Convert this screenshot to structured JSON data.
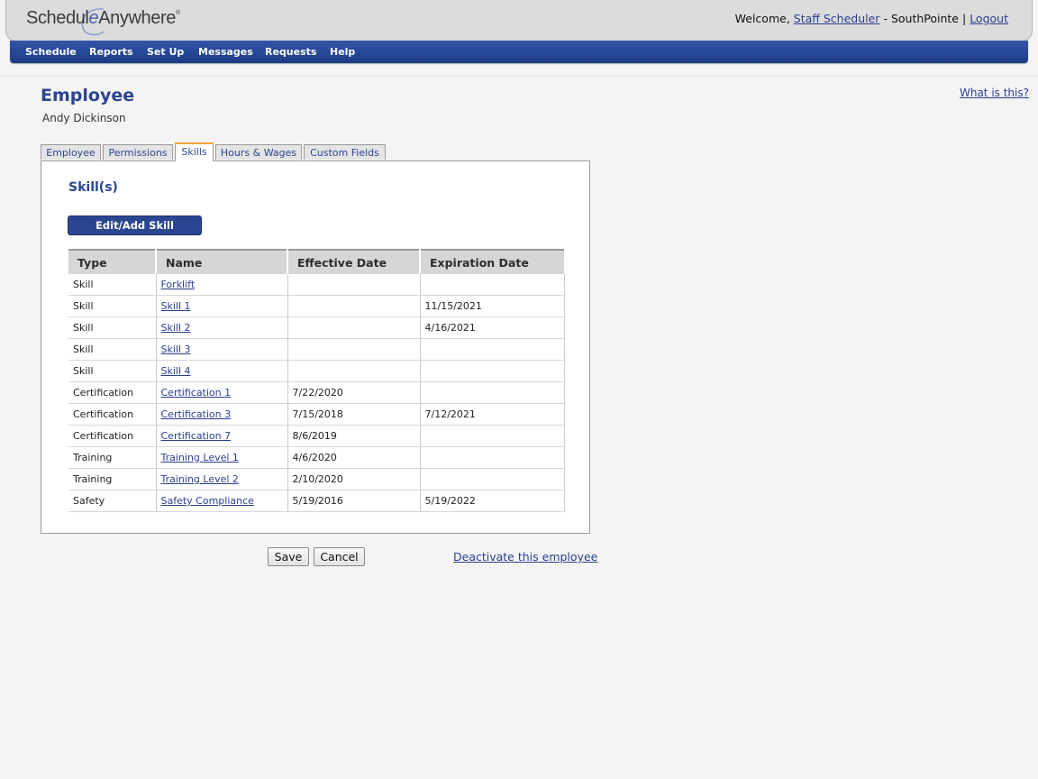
{
  "header": {
    "logo": {
      "prefix": "Schedul",
      "e": "e",
      "suffix": "Anywhere",
      "mark": "®"
    },
    "welcome_label": "Welcome,",
    "user_link": "Staff Scheduler",
    "separator": "-",
    "location": "SouthPointe",
    "pipe": "|",
    "logout_link": "Logout"
  },
  "nav": {
    "items": [
      "Schedule",
      "Reports",
      "Set Up",
      "Messages",
      "Requests",
      "Help"
    ]
  },
  "page": {
    "title": "Employee",
    "employee_name": "Andy Dickinson",
    "help_link": "What is this?"
  },
  "tabs": [
    {
      "label": "Employee"
    },
    {
      "label": "Permissions"
    },
    {
      "label": "Skills",
      "active": true
    },
    {
      "label": "Hours & Wages"
    },
    {
      "label": "Custom Fields"
    }
  ],
  "skills_panel": {
    "heading": "Skill(s)",
    "edit_button": "Edit/Add Skill",
    "columns": [
      "Type",
      "Name",
      "Effective Date",
      "Expiration Date"
    ],
    "rows": [
      {
        "type": "Skill",
        "name": "Forklift",
        "effective": "",
        "expiration": ""
      },
      {
        "type": "Skill",
        "name": "Skill 1",
        "effective": "",
        "expiration": "11/15/2021"
      },
      {
        "type": "Skill",
        "name": "Skill 2",
        "effective": "",
        "expiration": "4/16/2021"
      },
      {
        "type": "Skill",
        "name": "Skill 3",
        "effective": "",
        "expiration": ""
      },
      {
        "type": "Skill",
        "name": "Skill 4",
        "effective": "",
        "expiration": ""
      },
      {
        "type": "Certification",
        "name": "Certification 1",
        "effective": "7/22/2020",
        "expiration": ""
      },
      {
        "type": "Certification",
        "name": "Certification 3",
        "effective": "7/15/2018",
        "expiration": "7/12/2021"
      },
      {
        "type": "Certification",
        "name": "Certification 7",
        "effective": "8/6/2019",
        "expiration": ""
      },
      {
        "type": "Training",
        "name": "Training Level 1",
        "effective": "4/6/2020",
        "expiration": ""
      },
      {
        "type": "Training",
        "name": "Training Level 2",
        "effective": "2/10/2020",
        "expiration": ""
      },
      {
        "type": "Safety",
        "name": "Safety Compliance",
        "effective": "5/19/2016",
        "expiration": "5/19/2022"
      }
    ]
  },
  "footer": {
    "save": "Save",
    "cancel": "Cancel",
    "deactivate": "Deactivate this employee"
  },
  "colors": {
    "brand_blue": "#2b4690",
    "nav_blue": "#1d3b86",
    "active_tab_accent": "#f0a63a"
  }
}
